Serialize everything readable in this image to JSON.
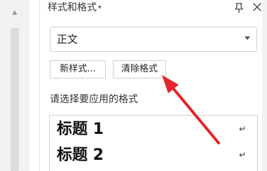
{
  "panel": {
    "title": "样式和格式",
    "title_caret": "▾",
    "pin_icon": "pin-icon",
    "close_icon": "close-icon"
  },
  "style_select": {
    "value": "正文"
  },
  "buttons": {
    "new_style": "新样式...",
    "clear_format": "清除格式"
  },
  "apply_label": "请选择要应用的格式",
  "style_list": {
    "items": [
      {
        "label": "标题 1",
        "return_mark": "↵"
      },
      {
        "label": "标题 2",
        "return_mark": "↵"
      }
    ]
  },
  "annotation": {
    "arrow_color": "#e0262a"
  },
  "left_scroll_arrow": "▲"
}
